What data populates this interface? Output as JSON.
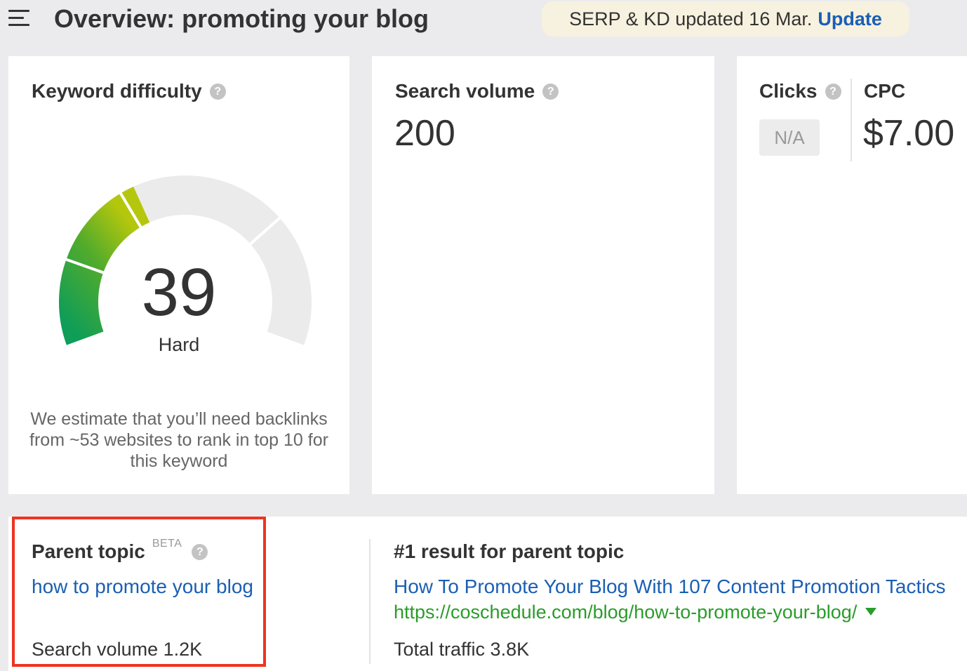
{
  "header": {
    "title": "Overview: promoting your blog",
    "banner_text": "SERP & KD updated 16 Mar.",
    "banner_action": "Update"
  },
  "keyword_difficulty": {
    "title": "Keyword difficulty",
    "help": "?",
    "value": "39",
    "level": "Hard",
    "gauge_fraction": 0.39,
    "estimate": "We estimate that you’ll need backlinks from ~53 websites to rank in top 10 for this keyword"
  },
  "search_volume": {
    "title": "Search volume",
    "help": "?",
    "value": "200"
  },
  "clicks": {
    "title": "Clicks",
    "help": "?",
    "value": "N/A"
  },
  "cpc": {
    "title": "CPC",
    "value": "$7.00"
  },
  "parent_topic": {
    "title": "Parent topic",
    "badge": "BETA",
    "help": "?",
    "keyword": "how to promote your blog",
    "search_volume": "Search volume 1.2K"
  },
  "top_result": {
    "title": "#1 result for parent topic",
    "page_title": "How To Promote Your Blog With 107 Content Promotion Tactics",
    "url": "https://coschedule.com/blog/how-to-promote-your-blog/",
    "total_traffic": "Total traffic 3.8K"
  },
  "colors": {
    "link": "#1a5fb4",
    "url": "#2a9c2a",
    "highlight": "#ee3322",
    "gauge_track": "#ebebeb",
    "gauge_green": "#0f9d58",
    "gauge_lime": "#a6c31b"
  }
}
